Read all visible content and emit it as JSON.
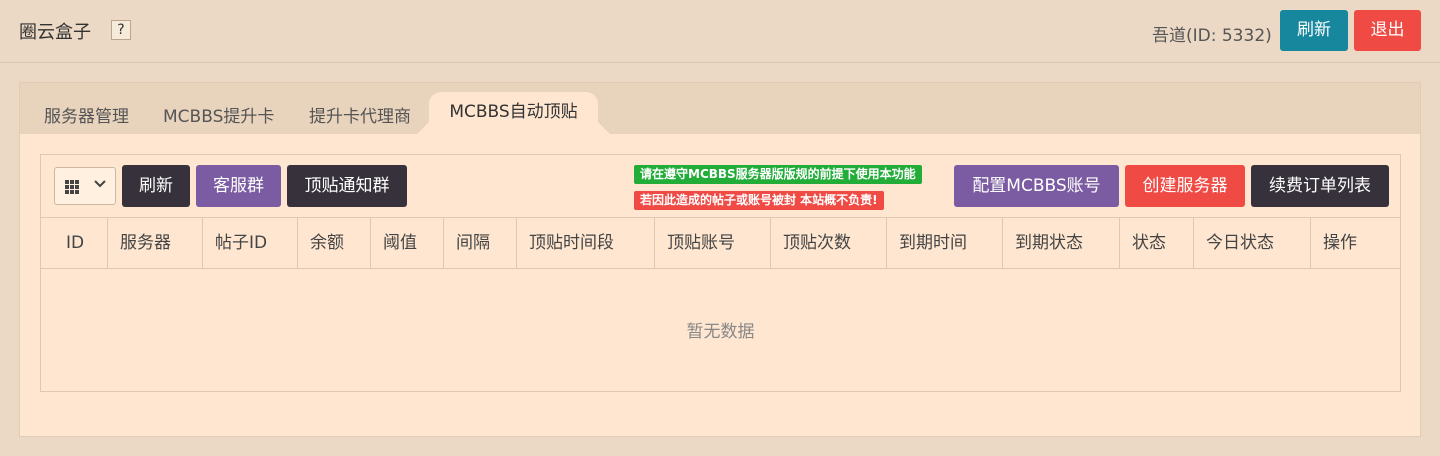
{
  "header": {
    "title": "圈云盒子",
    "help": "?",
    "user": "吾道(ID: 5332)",
    "refresh_label": "刷新",
    "logout_label": "退出"
  },
  "tabs": [
    {
      "label": "服务器管理"
    },
    {
      "label": "MCBBS提升卡"
    },
    {
      "label": "提升卡代理商"
    },
    {
      "label": "MCBBS自动顶贴"
    }
  ],
  "toolbar": {
    "refresh_label": "刷新",
    "support_label": "客服群",
    "notify_label": "顶贴通知群",
    "notice1": "请在遵守MCBBS服务器版版规的前提下使用本功能",
    "notice2": "若因此造成的帖子或账号被封 本站概不负责!",
    "config_label": "配置MCBBS账号",
    "create_label": "创建服务器",
    "orders_label": "续费订单列表"
  },
  "table": {
    "columns": [
      "ID",
      "服务器",
      "帖子ID",
      "余额",
      "阈值",
      "间隔",
      "顶贴时间段",
      "顶贴账号",
      "顶贴次数",
      "到期时间",
      "到期状态",
      "状态",
      "今日状态",
      "操作"
    ],
    "empty_text": "暂无数据"
  },
  "colors": {
    "teal": "#17879e",
    "red": "#ef4a44",
    "dark": "#36313a",
    "purple": "#7b5ba1",
    "green": "#22ac38"
  }
}
